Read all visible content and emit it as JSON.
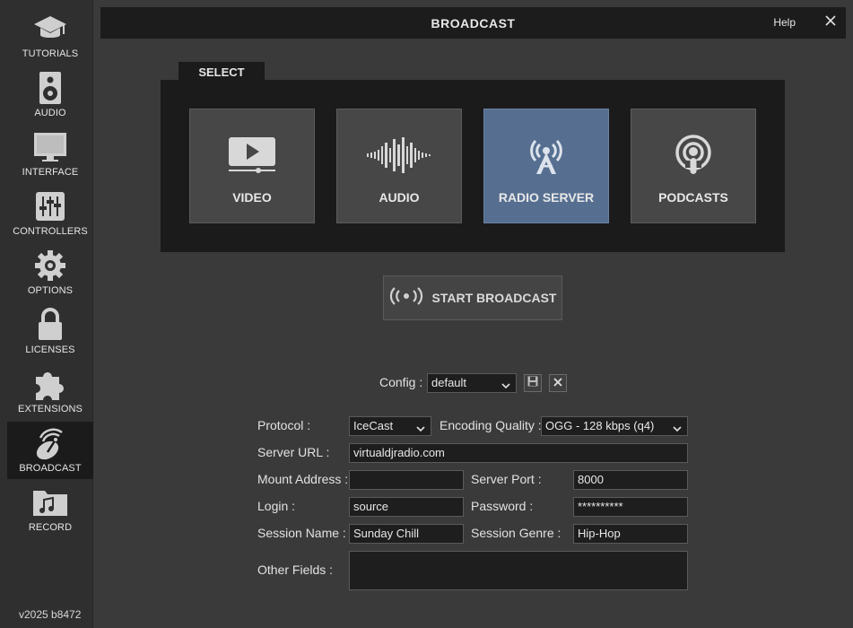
{
  "sidebar": {
    "items": [
      {
        "label": "TUTORIALS",
        "icon": "graduation-cap-icon"
      },
      {
        "label": "AUDIO",
        "icon": "speaker-icon"
      },
      {
        "label": "INTERFACE",
        "icon": "monitor-icon"
      },
      {
        "label": "CONTROLLERS",
        "icon": "sliders-icon"
      },
      {
        "label": "OPTIONS",
        "icon": "gear-icon"
      },
      {
        "label": "LICENSES",
        "icon": "lock-icon"
      },
      {
        "label": "EXTENSIONS",
        "icon": "puzzle-icon"
      },
      {
        "label": "BROADCAST",
        "icon": "broadcast-dish-icon"
      },
      {
        "label": "RECORD",
        "icon": "music-folder-icon"
      }
    ],
    "active_index": 7,
    "version": "v2025 b8472"
  },
  "header": {
    "title": "BROADCAST",
    "help": "Help",
    "close_icon": "close-icon"
  },
  "select": {
    "tab_label": "SELECT",
    "modes": [
      {
        "label": "VIDEO",
        "icon": "video-play-icon"
      },
      {
        "label": "AUDIO",
        "icon": "waveform-icon"
      },
      {
        "label": "RADIO SERVER",
        "icon": "radio-tower-icon"
      },
      {
        "label": "PODCASTS",
        "icon": "podcast-icon"
      }
    ],
    "selected_index": 2
  },
  "start_broadcast": {
    "label": "START BROADCAST",
    "icon": "broadcast-waves-icon"
  },
  "config": {
    "label": "Config :",
    "value": "default",
    "save_icon": "floppy-save-icon",
    "delete_icon": "close-icon"
  },
  "form": {
    "protocol_label": "Protocol :",
    "protocol_value": "IceCast",
    "encoding_label": "Encoding Quality :",
    "encoding_value": "OGG - 128 kbps (q4)",
    "server_url_label": "Server URL :",
    "server_url_value": "virtualdjradio.com",
    "mount_label": "Mount Address :",
    "mount_value": "",
    "port_label": "Server Port :",
    "port_value": "8000",
    "login_label": "Login :",
    "login_value": "source",
    "password_label": "Password :",
    "password_value": "**********",
    "session_name_label": "Session Name :",
    "session_name_value": "Sunday Chill",
    "session_genre_label": "Session Genre :",
    "session_genre_value": "Hip-Hop",
    "other_label": "Other Fields :",
    "other_value": ""
  },
  "colors": {
    "background": "#3a3a3a",
    "panel": "#1b1b1b",
    "tile": "#474747",
    "tile_selected": "#566f91"
  }
}
